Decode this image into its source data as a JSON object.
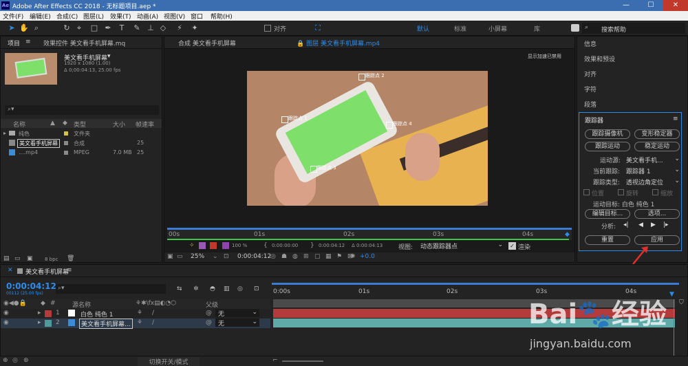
{
  "window": {
    "title": "Adobe After Effects CC 2018 - 无标题项目.aep *",
    "app_icon": "Ae",
    "minimize": "—",
    "maximize": "☐",
    "close": "✕"
  },
  "menu": [
    "文件(F)",
    "编辑(E)",
    "合成(C)",
    "图层(L)",
    "效果(T)",
    "动画(A)",
    "视图(V)",
    "窗口",
    "帮助(H)"
  ],
  "toolbar": {
    "snap_label": "对齐",
    "workspaces": [
      "默认",
      "标准",
      "小屏幕",
      "库"
    ],
    "search_placeholder": "搜索帮助"
  },
  "project": {
    "tab": "项目",
    "tab_menu": "≡",
    "effects_tab": "效果控件 美文看手机屏幕.mq",
    "item_name": "美文看手机屏幕",
    "item_res": "1920 x 1080 (1.00)",
    "item_dur": "Δ 0;00:04:13, 25.00 fps",
    "search_placeholder": "",
    "columns": [
      "名称",
      "类型",
      "大小",
      "帧速率"
    ],
    "rows": [
      {
        "name": "纯色",
        "type": "文件夹",
        "size": "",
        "fps": ""
      },
      {
        "name": "美文看手机屏幕",
        "type": "合成",
        "size": "",
        "fps": "25"
      },
      {
        "name": "....mp4",
        "type": "MPEG",
        "size": "7.0 MB",
        "fps": "25"
      }
    ],
    "bpc": "8 bpc"
  },
  "viewer": {
    "comp_tab": "合成 美文看手机屏幕",
    "layer_tab": "图层 美文看手机屏幕.mp4",
    "hint": "显示加速已禁用",
    "track_points": [
      "跟踪点 1",
      "跟踪点 2",
      "跟踪点 3",
      "跟踪点 4"
    ],
    "ruler": [
      "00s",
      "01s",
      "02s",
      "03s",
      "04s"
    ],
    "opacity": "100 %",
    "in": "0:00:00:00",
    "out": "0:00:04:12",
    "dur": "Δ 0:00:04:13",
    "view_label": "视图:",
    "view_value": "动态跟踪器点",
    "render_label": "渲染",
    "zoom": "25%",
    "timecode": "0:00:04:12",
    "exposure": "+0.0"
  },
  "right_panels": [
    "信息",
    "效果和预设",
    "对齐",
    "字符",
    "段落"
  ],
  "tracker": {
    "title": "跟踪器",
    "menu": "≡",
    "buttons": [
      "跟踪摄像机",
      "变形稳定器",
      "跟踪运动",
      "稳定运动"
    ],
    "source_label": "运动源:",
    "source_value": "美文看手机...",
    "current_label": "当前跟踪:",
    "current_value": "跟踪器 1",
    "type_label": "跟踪类型:",
    "type_value": "透视边角定位",
    "checks": [
      "位置",
      "旋转",
      "缩放"
    ],
    "target_label": "运动目标: 白色 纯色 1",
    "edit_target": "编辑目标...",
    "options": "选项...",
    "analyze_label": "分析:",
    "reset": "重置",
    "apply": "应用"
  },
  "timeline": {
    "tab": "美文看手机屏幕",
    "timecode": "0:00:04:12",
    "frame_info": "00112 (25.00 fps)",
    "col_source": "源名称",
    "col_parent": "父级",
    "ruler": [
      "0:00s",
      "01s",
      "02s",
      "03s",
      "04s"
    ],
    "layers": [
      {
        "num": "1",
        "name": "白色 纯色 1",
        "parent": "无",
        "color": "#b43b3b"
      },
      {
        "num": "2",
        "name": "美文看手机屏幕...",
        "parent": "无",
        "color": "#4f9a9a"
      }
    ],
    "footer": "切换开关/模式"
  },
  "watermark": {
    "logo": "Bai",
    "logo2": "经验",
    "url": "jingyan.baidu.com"
  }
}
